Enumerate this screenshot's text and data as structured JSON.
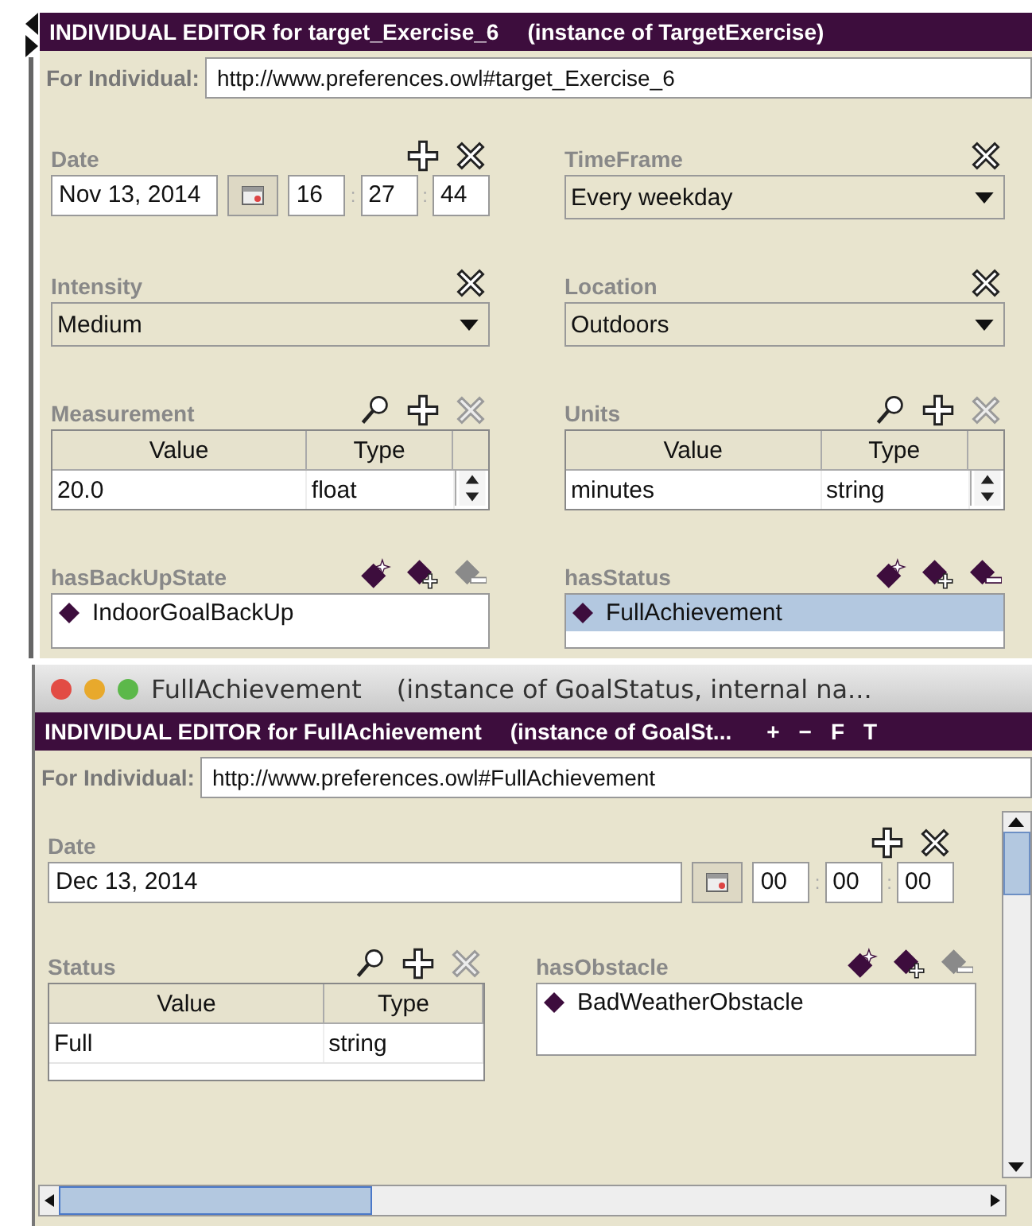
{
  "editor": {
    "title": "INDIVIDUAL EDITOR for target_Exercise_6",
    "subtitle": "(instance of TargetExercise)",
    "individual_label": "For Individual:",
    "individual": "http://www.preferences.owl#target_Exercise_6",
    "widgets": [
      {
        "kind": "date",
        "label": "Date",
        "date": "Nov 13, 2014",
        "time": [
          "16",
          "27",
          "44"
        ],
        "time_separator": ":",
        "icons": [
          {
            "kind": "add",
            "disabled": false
          },
          {
            "kind": "delete",
            "disabled": false
          }
        ]
      },
      {
        "kind": "combo",
        "label": "TimeFrame",
        "value": "Every weekday",
        "icons": [
          {
            "kind": "delete",
            "disabled": false
          }
        ]
      },
      {
        "kind": "combo",
        "label": "Intensity",
        "value": "Medium",
        "icons": [
          {
            "kind": "delete",
            "disabled": false
          }
        ]
      },
      {
        "kind": "combo",
        "label": "Location",
        "value": "Outdoors",
        "icons": [
          {
            "kind": "delete",
            "disabled": false
          }
        ]
      },
      {
        "kind": "table",
        "label": "Measurement",
        "columns": [
          "Value",
          "Type"
        ],
        "rows": [
          [
            "20.0",
            "float"
          ]
        ],
        "spinner": true,
        "icons": [
          {
            "kind": "search",
            "disabled": false
          },
          {
            "kind": "add",
            "disabled": false
          },
          {
            "kind": "delete",
            "disabled": true
          }
        ]
      },
      {
        "kind": "table",
        "label": "Units",
        "columns": [
          "Value",
          "Type"
        ],
        "rows": [
          [
            "minutes",
            "string"
          ]
        ],
        "spinner": true,
        "icons": [
          {
            "kind": "search",
            "disabled": false
          },
          {
            "kind": "add",
            "disabled": false
          },
          {
            "kind": "delete",
            "disabled": true
          }
        ]
      },
      {
        "kind": "instances",
        "label": "hasBackUpState",
        "items": [
          {
            "name": "IndoorGoalBackUp",
            "selected": false
          }
        ],
        "icons": [
          {
            "kind": "create-instance",
            "disabled": false
          },
          {
            "kind": "add-instance",
            "disabled": false
          },
          {
            "kind": "remove-instance",
            "disabled": true
          }
        ]
      },
      {
        "kind": "instances",
        "label": "hasStatus",
        "items": [
          {
            "name": "FullAchievement",
            "selected": true
          }
        ],
        "icons": [
          {
            "kind": "create-instance",
            "disabled": false
          },
          {
            "kind": "add-instance",
            "disabled": false
          },
          {
            "kind": "remove-instance",
            "disabled": false
          }
        ]
      }
    ]
  },
  "popup": {
    "window_title": "FullAchievement",
    "window_subtitle": "(instance of GoalStatus, internal na...",
    "editor": {
      "title": "INDIVIDUAL EDITOR for FullAchievement",
      "subtitle": "(instance of GoalSt...",
      "title_buttons": [
        "+",
        "−",
        "F",
        "T"
      ],
      "individual_label": "For Individual:",
      "individual": "http://www.preferences.owl#FullAchievement",
      "widgets": [
        {
          "kind": "date",
          "wide": true,
          "label": "Date",
          "date": "Dec 13, 2014",
          "time": [
            "00",
            "00",
            "00"
          ],
          "time_separator": ":",
          "icons": [
            {
              "kind": "add",
              "disabled": false
            },
            {
              "kind": "delete",
              "disabled": false
            }
          ]
        },
        {
          "kind": "table",
          "label": "Status",
          "columns": [
            "Value",
            "Type"
          ],
          "rows": [
            [
              "Full",
              "string"
            ]
          ],
          "spinner": false,
          "icons": [
            {
              "kind": "search",
              "disabled": false
            },
            {
              "kind": "add",
              "disabled": false
            },
            {
              "kind": "delete",
              "disabled": true
            }
          ]
        },
        {
          "kind": "instances",
          "label": "hasObstacle",
          "items": [
            {
              "name": "BadWeatherObstacle",
              "selected": false
            }
          ],
          "icons": [
            {
              "kind": "create-instance",
              "disabled": false
            },
            {
              "kind": "add-instance",
              "disabled": false
            },
            {
              "kind": "remove-instance",
              "disabled": true
            }
          ]
        }
      ]
    }
  }
}
